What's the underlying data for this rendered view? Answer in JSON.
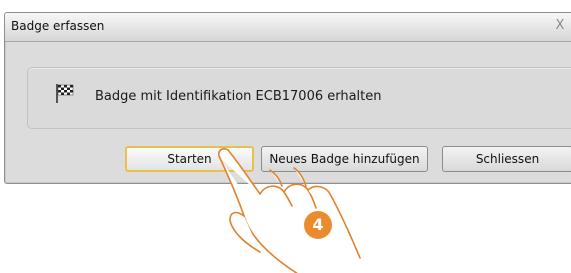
{
  "dialog": {
    "title": "Badge erfassen",
    "close_symbol": "X"
  },
  "message": {
    "icon": "checkered-flag-icon",
    "text": "Badge mit Identifikation ECB17006 erhalten"
  },
  "buttons": {
    "start_label": "Starten",
    "new_badge_label": "Neues Badge hinzufügen",
    "close_label": "Schliessen"
  },
  "annotation": {
    "step_number": "4",
    "step_color": "#ea8b2e",
    "pointer_icon": "hand-pointer-icon"
  },
  "colors": {
    "focus_border": "#e9c04b"
  }
}
